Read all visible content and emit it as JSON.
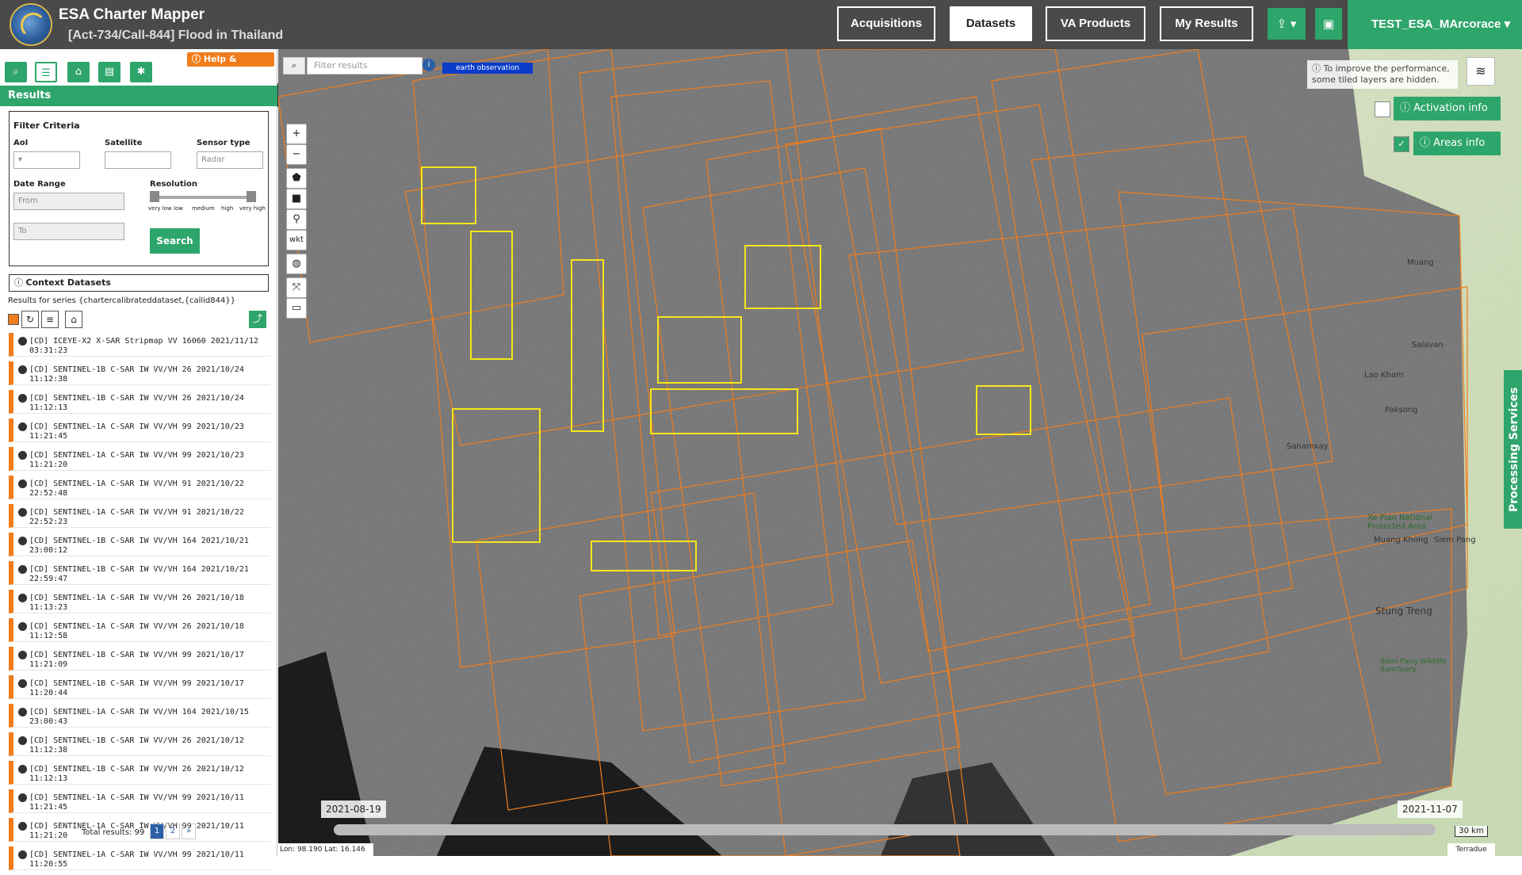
{
  "header": {
    "app_title": "ESA Charter Mapper",
    "activation_title": "[Act-734/Call-844] Flood in Thailand",
    "nav": {
      "acquisitions": "Acquisitions",
      "datasets": "Datasets",
      "va_products": "VA Products",
      "my_results": "My Results"
    },
    "upload_icon": "upload-icon",
    "briefcase_icon": "briefcase-icon",
    "user": "TEST_ESA_MArcorace"
  },
  "sidebar": {
    "help_label": "Help & Manual",
    "results_label": "Results",
    "filter": {
      "title": "Filter Criteria",
      "aoi_label": "AoI",
      "satellite_label": "Satellite",
      "sensor_label": "Sensor type",
      "sensor_value": "Radar",
      "date_label": "Date Range",
      "from_placeholder": "From",
      "to_placeholder": "To",
      "resolution_label": "Resolution",
      "res_levels": [
        "very low",
        "low",
        "medium",
        "high",
        "very high"
      ],
      "search_label": "Search"
    },
    "context_label": "Context Datasets",
    "series_text": "Results for series {chartercalibrateddataset,{callid844}}",
    "datasets": [
      "[CD] ICEYE-X2 X-SAR Stripmap VV 16060 2021/11/12 03:31:23",
      "[CD] SENTINEL-1B C-SAR IW VV/VH 26 2021/10/24 11:12:38",
      "[CD] SENTINEL-1B C-SAR IW VV/VH 26 2021/10/24 11:12:13",
      "[CD] SENTINEL-1A C-SAR IW VV/VH 99 2021/10/23 11:21:45",
      "[CD] SENTINEL-1A C-SAR IW VV/VH 99 2021/10/23 11:21:20",
      "[CD] SENTINEL-1A C-SAR IW VV/VH 91 2021/10/22 22:52:48",
      "[CD] SENTINEL-1A C-SAR IW VV/VH 91 2021/10/22 22:52:23",
      "[CD] SENTINEL-1B C-SAR IW VV/VH 164 2021/10/21 23:00:12",
      "[CD] SENTINEL-1B C-SAR IW VV/VH 164 2021/10/21 22:59:47",
      "[CD] SENTINEL-1A C-SAR IW VV/VH 26 2021/10/18 11:13:23",
      "[CD] SENTINEL-1A C-SAR IW VV/VH 26 2021/10/18 11:12:58",
      "[CD] SENTINEL-1B C-SAR IW VV/VH 99 2021/10/17 11:21:09",
      "[CD] SENTINEL-1B C-SAR IW VV/VH 99 2021/10/17 11:20:44",
      "[CD] SENTINEL-1A C-SAR IW VV/VH 164 2021/10/15 23:00:43",
      "[CD] SENTINEL-1B C-SAR IW VV/VH 26 2021/10/12 11:12:38",
      "[CD] SENTINEL-1B C-SAR IW VV/VH 26 2021/10/12 11:12:13",
      "[CD] SENTINEL-1A C-SAR IW VV/VH 99 2021/10/11 11:21:45",
      "[CD] SENTINEL-1A C-SAR IW VV/VH 99 2021/10/11 11:21:20",
      "[CD] SENTINEL-1A C-SAR IW VV/VH 99 2021/10/11 11:20:55"
    ],
    "total_results": "Total results: 99",
    "pages": [
      "1",
      "2",
      "»"
    ]
  },
  "map": {
    "filter_placeholder": "Filter results",
    "eo_tag": "earth observation",
    "wkt_label": "wkt",
    "perf_note": "To improve the performance, some tiled layers are hidden.",
    "activation_info": "Activation info",
    "areas_info": "Areas info",
    "processing_services": "Processing Services",
    "timeline_start": "2021-08-19",
    "timeline_end": "2021-11-07",
    "coords": "Lon: 98.190 Lat: 16.146",
    "scale": "30 km",
    "attribution": "Terradue",
    "towns": [
      "Muang",
      "Salavan",
      "Lao Kham",
      "Paksong",
      "Sanamxay",
      "Xe Pian National Protected Area",
      "Muang Khong",
      "Siem Pang",
      "Stung Treng",
      "Siem Pang Wildlife Sanctuary"
    ]
  },
  "colors": {
    "header_bg": "#4a4a4a",
    "accent_green": "#2ea56b",
    "accent_orange": "#f07c1b",
    "footprint": "#f07c1b",
    "aoi": "#f5e61a"
  }
}
